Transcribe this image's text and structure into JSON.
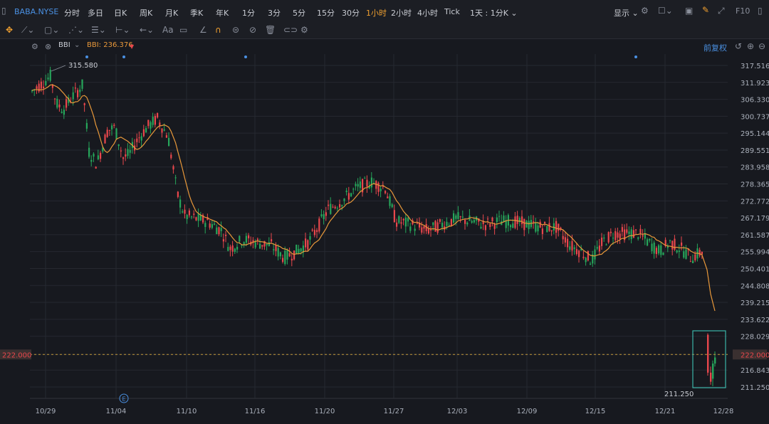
{
  "toolbar": {
    "symbol": "BABA.NYSE",
    "periods": [
      "分时",
      "多日",
      "日K",
      "周K",
      "月K",
      "季K",
      "年K",
      "1分",
      "3分",
      "5分",
      "15分",
      "30分",
      "1小时",
      "2小时",
      "4小时",
      "Tick"
    ],
    "active_period": "1小时",
    "combo_label": "1天 : 1分K",
    "display_label": "显示",
    "code_icon": "F10"
  },
  "drawing_tools": [
    "crosshair-icon",
    "line-tools-icon",
    "shape-tools-icon",
    "text-tools-icon",
    "measure-tools-icon",
    "arrow-tools-icon"
  ],
  "drawing_text_label": "Aa",
  "indicator": {
    "name": "BBI",
    "value_label": "BBI: 236.376",
    "adjust_label": "前复权"
  },
  "price_axis": {
    "labels": [
      "317.516",
      "311.923",
      "306.330",
      "300.737",
      "295.144",
      "289.551",
      "283.958",
      "278.365",
      "272.772",
      "267.179",
      "261.587",
      "255.994",
      "250.401",
      "244.808",
      "239.215",
      "233.622",
      "228.029",
      "222.000",
      "216.843",
      "211.250"
    ]
  },
  "time_axis": {
    "labels": [
      "10/29",
      "11/04",
      "11/10",
      "11/16",
      "11/20",
      "11/27",
      "12/03",
      "12/09",
      "12/15",
      "12/21",
      "12/28"
    ]
  },
  "annotations": {
    "high": "315.580",
    "low": "211.250",
    "current_price": "222.000",
    "event_marker": "E"
  },
  "colors": {
    "up": "#26a65b",
    "down": "#e8474c",
    "bbi": "#e8983a",
    "current_line": "#c49a3a",
    "highlight_box": "#3ab5a8",
    "background": "#17191f",
    "grid": "#262930"
  }
}
